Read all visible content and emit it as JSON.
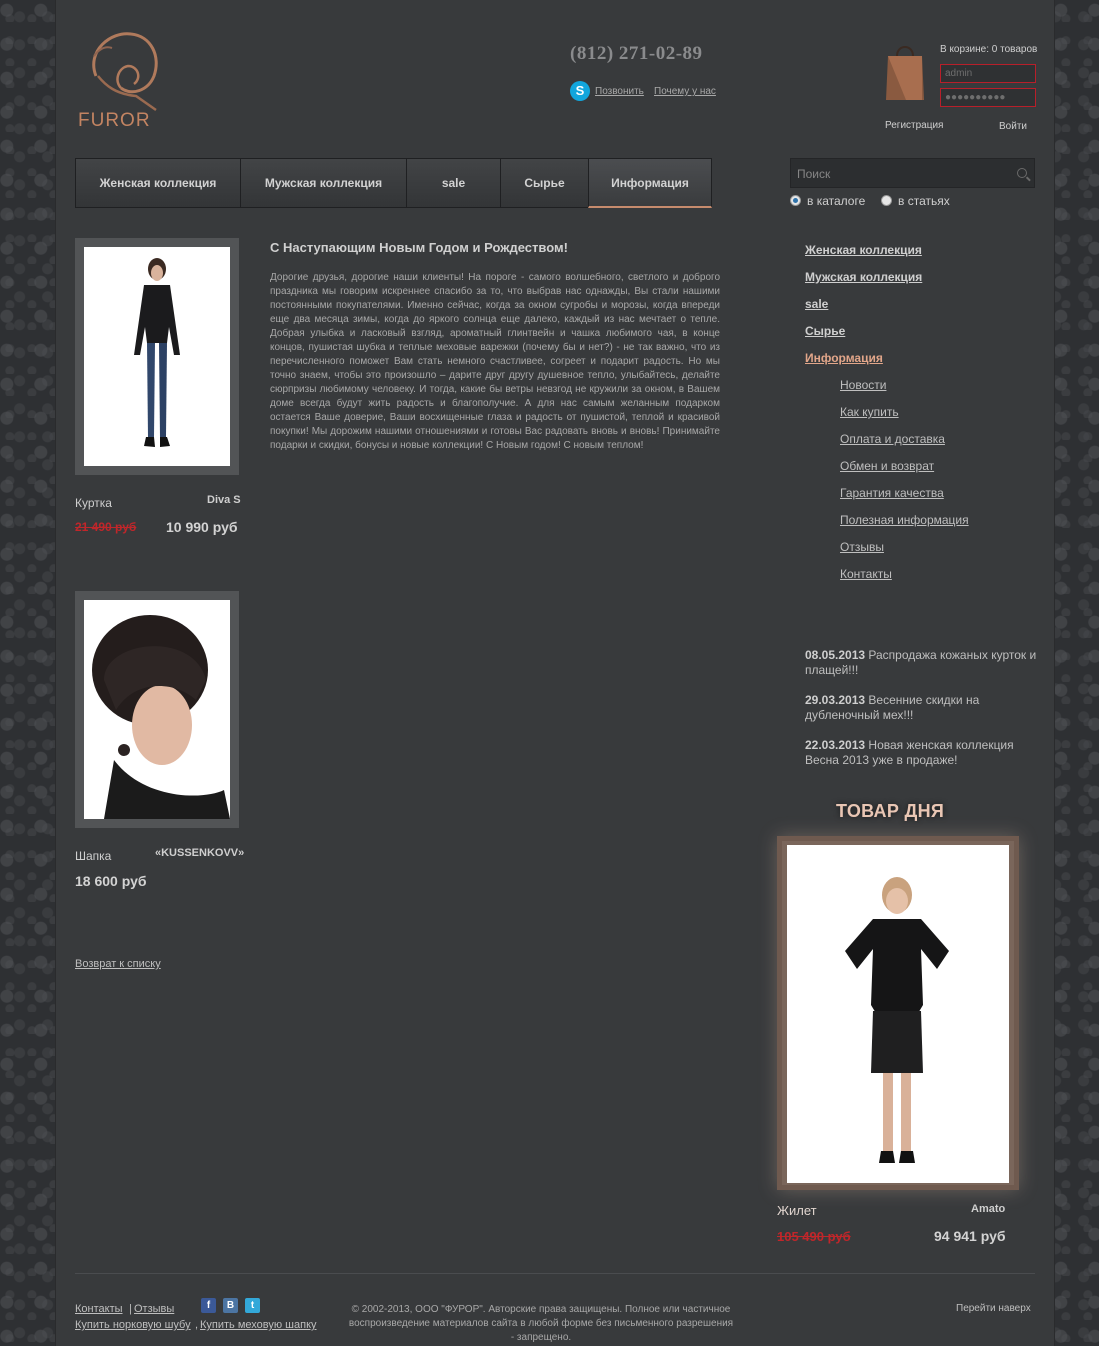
{
  "header": {
    "logo_text": "FUROR",
    "phone": "(812) 271-02-89",
    "call_link": "Позвонить",
    "why_us_link": "Почему у нас",
    "cart_text": "В корзине: 0 товаров",
    "login_value": "admin",
    "password_value": "●●●●●●●●●●",
    "register_link": "Регистрация",
    "login_link": "Войти"
  },
  "nav": {
    "items": [
      {
        "label": "Женская коллекция"
      },
      {
        "label": "Мужская коллекция"
      },
      {
        "label": "sale"
      },
      {
        "label": "Сырье"
      },
      {
        "label": "Информация"
      }
    ]
  },
  "search": {
    "placeholder": "Поиск",
    "option_catalog": "в каталоге",
    "option_articles": "в статьях",
    "selected": "в каталоге"
  },
  "products": [
    {
      "name": "Куртка",
      "brand": "Diva S",
      "old_price": "21 490 руб",
      "price": "10 990 руб"
    },
    {
      "name": "Шапка",
      "brand": "«KUSSENKOVV»",
      "old_price": "",
      "price": "18 600 руб"
    }
  ],
  "back_link": "Возврат к списку",
  "article": {
    "title": "С Наступающим Новым Годом и Рождеством!",
    "body": "Дорогие друзья, дорогие наши клиенты! На пороге - самого волшебного, светлого и доброго праздника мы говорим искреннее спасибо за то, что выбрав нас однажды, Вы стали нашими постоянными покупателями. Именно сейчас, когда за окном сугробы и морозы, когда впереди еще два месяца зимы, когда до яркого солнца еще далеко, каждый из нас мечтает о тепле. Добрая улыбка и ласковый взгляд, ароматный глинтвейн и чашка любимого чая, в конце концов, пушистая шубка и теплые меховые варежки (почему бы и нет?) - не так важно, что из перечисленного поможет Вам стать немного счастливее, согреет и подарит радость. Но мы точно знаем, чтобы это произошло – дарите друг другу душевное тепло, улыбайтесь, делайте сюрпризы любимому человеку. И тогда, какие бы ветры невзгод не кружили за окном, в Вашем доме всегда будут жить радость и благополучие. А для нас самым желанным подарком остается Ваше доверие, Ваши восхищенные глаза и радость от пушистой, теплой и красивой покупки! Мы дорожим нашими отношениями и готовы Вас радовать вновь и вновь! Принимайте подарки и скидки, бонусы и новые коллекции! С Новым годом! С новым теплом!"
  },
  "side_menu": {
    "main": [
      {
        "label": "Женская коллекция"
      },
      {
        "label": "Мужская коллекция"
      },
      {
        "label": "sale"
      },
      {
        "label": "Сырье"
      },
      {
        "label": "Информация"
      }
    ],
    "sub": [
      {
        "label": "Новости"
      },
      {
        "label": "Как купить"
      },
      {
        "label": "Оплата и доставка"
      },
      {
        "label": "Обмен и возврат"
      },
      {
        "label": "Гарантия качества"
      },
      {
        "label": "Полезная информация"
      },
      {
        "label": "Отзывы"
      },
      {
        "label": "Контакты"
      }
    ]
  },
  "news": [
    {
      "date": "08.05.2013",
      "text": "Распродажа кожаных курток и плащей!!!"
    },
    {
      "date": "29.03.2013",
      "text": "Весенние скидки на дубленочный мех!!!"
    },
    {
      "date": "22.03.2013",
      "text": "Новая женская коллекция Весна 2013 уже в продаже!"
    }
  ],
  "day_product": {
    "heading": "ТОВАР ДНЯ",
    "name": "Жилет",
    "brand": "Amato",
    "old_price": "105 490 руб",
    "price": "94 941 руб"
  },
  "footer": {
    "contacts": "Контакты",
    "separator": "|",
    "reviews": "Отзывы",
    "buy_mink": "Купить норковую шубу",
    "comma": ",",
    "buy_hat": "Купить меховую шапку",
    "copyright": "© 2002-2013, ООО \"ФУРОР\". Авторские права защищены. Полное или частичное воспроизведение материалов сайта в любой форме без письменного разрешения - запрещено.",
    "go_top": "Перейти наверх",
    "social": [
      "f",
      "B",
      "t"
    ]
  },
  "colors": {
    "accent": "#e2a68a",
    "sale_red": "#c0262a",
    "page_bg": "#383a3c"
  }
}
